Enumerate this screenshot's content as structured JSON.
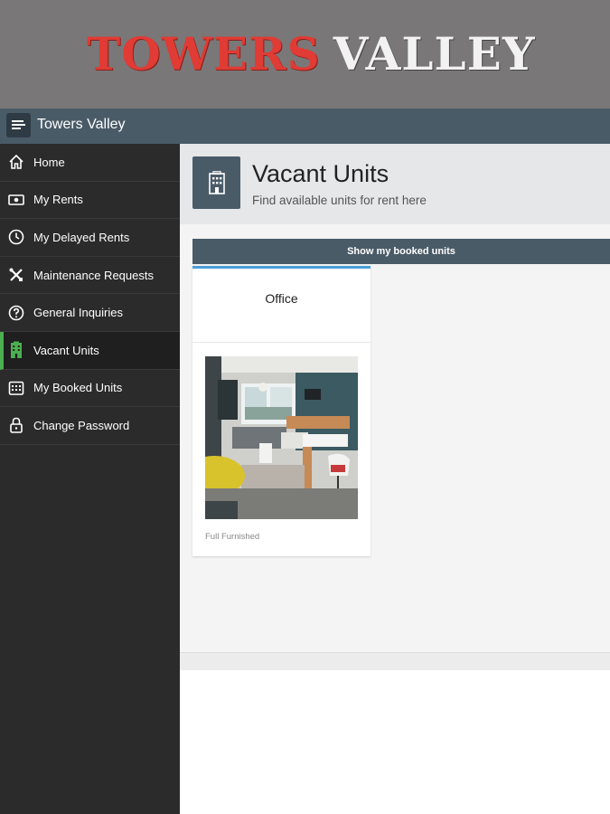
{
  "banner": {
    "logo_part1": "TOWERS",
    "logo_part2": "VALLEY"
  },
  "topbar": {
    "title": "Towers Valley"
  },
  "sidebar": {
    "items": [
      {
        "label": "Home",
        "icon": "home-icon"
      },
      {
        "label": "My Rents",
        "icon": "cash-icon"
      },
      {
        "label": "My Delayed Rents",
        "icon": "clock-icon"
      },
      {
        "label": "Maintenance Requests",
        "icon": "tools-icon"
      },
      {
        "label": "General Inquiries",
        "icon": "question-icon"
      },
      {
        "label": "Vacant Units",
        "icon": "building-icon"
      },
      {
        "label": "My Booked Units",
        "icon": "calendar-icon"
      },
      {
        "label": "Change Password",
        "icon": "lock-icon"
      }
    ],
    "active_index": 5
  },
  "header": {
    "title": "Vacant Units",
    "subtitle": "Find available units for rent here"
  },
  "content": {
    "booked_button": "Show my booked units",
    "units": [
      {
        "type": "Office",
        "description": "Full Furnished"
      }
    ]
  },
  "colors": {
    "accent": "#4a5b68",
    "active": "#4caf50",
    "logo_red": "#e03b34"
  }
}
